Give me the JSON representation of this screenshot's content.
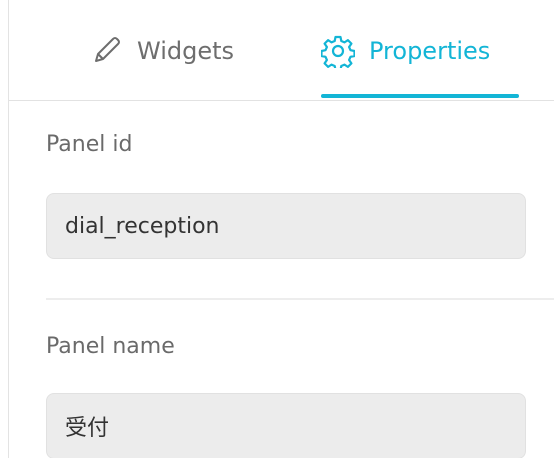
{
  "tabs": {
    "widgets": {
      "label": "Widgets",
      "icon": "pencil-icon"
    },
    "properties": {
      "label": "Properties",
      "icon": "gear-icon",
      "active": true
    }
  },
  "panel_id": {
    "label": "Panel id",
    "value": "dial_reception"
  },
  "panel_name": {
    "label": "Panel name",
    "value": "受付"
  },
  "colors": {
    "accent": "#13b5d6",
    "inactive_text": "#6e6e6e",
    "field_bg": "#ececec"
  }
}
